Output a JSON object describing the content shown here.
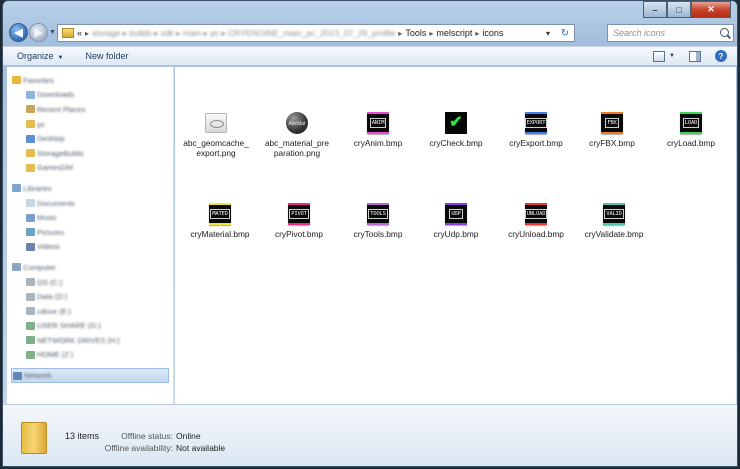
{
  "window": {
    "caption_min": "–",
    "caption_max": "□",
    "caption_close": "✕"
  },
  "nav": {
    "back_glyph": "◀",
    "forward_glyph": "▶",
    "dropdown_glyph": "▼"
  },
  "address": {
    "prefix": "«",
    "blurred_path": "storage ▸ builds ▸ sdk ▸ main ▸ pc ▸ CRYENGINE_main_pc_2013_07_26_profile",
    "segments": [
      "Tools",
      "melscript",
      "icons"
    ],
    "separator": "▸",
    "dropdown_glyph": "▾",
    "refresh_glyph": "↻"
  },
  "search": {
    "placeholder": "Search icons"
  },
  "toolbar": {
    "organize_label": "Organize",
    "caret": "▼",
    "new_folder_label": "New folder",
    "help_glyph": "?"
  },
  "navpane": {
    "favorites": {
      "label": "Favorites",
      "items": [
        "Downloads",
        "Recent Places",
        "pc",
        "Desktop",
        "StorageBuilds",
        "GamesDM"
      ]
    },
    "libraries": {
      "label": "Libraries",
      "items": [
        "Documents",
        "Music",
        "Pictures",
        "Videos"
      ]
    },
    "computer": {
      "label": "Computer",
      "items": [
        "OS (C:)",
        "Data (D:)",
        "cdrive (E:)",
        "USER SHARE (G:)",
        "NETWORK DRIVES (H:)",
        "HOME (Z:)"
      ]
    },
    "network": {
      "label": "Network"
    }
  },
  "files": [
    {
      "name": "abc_geomcache_export.png",
      "line1": "abc_geomcache_",
      "line2": "export.png",
      "kind": "png-geom"
    },
    {
      "name": "abc_material_preparation.png",
      "line1": "abc_material_pre",
      "line2": "paration.png",
      "kind": "png-abc",
      "thumb_text": "AbcMat"
    },
    {
      "name": "cryAnim.bmp",
      "line1": "cryAnim.bmp",
      "line2": "",
      "kind": "btn",
      "label": "ANIM",
      "color": "#e94bd8"
    },
    {
      "name": "cryCheck.bmp",
      "line1": "cryCheck.bmp",
      "line2": "",
      "kind": "check",
      "glyph": "✔"
    },
    {
      "name": "cryExport.bmp",
      "line1": "cryExport.bmp",
      "line2": "",
      "kind": "btn",
      "label": "EXPORT",
      "color": "#3d7ff0"
    },
    {
      "name": "cryFBX.bmp",
      "line1": "cryFBX.bmp",
      "line2": "",
      "kind": "btn",
      "label": "FBX",
      "color": "#f07a26"
    },
    {
      "name": "cryLoad.bmp",
      "line1": "cryLoad.bmp",
      "line2": "",
      "kind": "btn",
      "label": "LOAD",
      "color": "#3fd34f"
    },
    {
      "name": "cryMaterial.bmp",
      "line1": "cryMaterial.bmp",
      "line2": "",
      "kind": "btn",
      "label": "MATED",
      "color": "#f3e43a"
    },
    {
      "name": "cryPivot.bmp",
      "line1": "cryPivot.bmp",
      "line2": "",
      "kind": "btn",
      "label": "PIVOT",
      "color": "#ec2f86"
    },
    {
      "name": "cryTools.bmp",
      "line1": "cryTools.bmp",
      "line2": "",
      "kind": "btn",
      "label": "TOOLS",
      "color": "#b86ad6"
    },
    {
      "name": "cryUdp.bmp",
      "line1": "cryUdp.bmp",
      "line2": "",
      "kind": "btn",
      "label": "UDP",
      "color": "#8a3fe6"
    },
    {
      "name": "cryUnload.bmp",
      "line1": "cryUnload.bmp",
      "line2": "",
      "kind": "btn",
      "label": "UNLOAD",
      "color": "#e53838"
    },
    {
      "name": "cryValidate.bmp",
      "line1": "cryValidate.bmp",
      "line2": "",
      "kind": "btn",
      "label": "VALID",
      "color": "#49c9b4"
    }
  ],
  "details": {
    "count": "13 items",
    "offline_status_label": "Offline status:",
    "offline_status_value": "Online",
    "offline_availability_label": "Offline availability:",
    "offline_availability_value": "Not available"
  }
}
